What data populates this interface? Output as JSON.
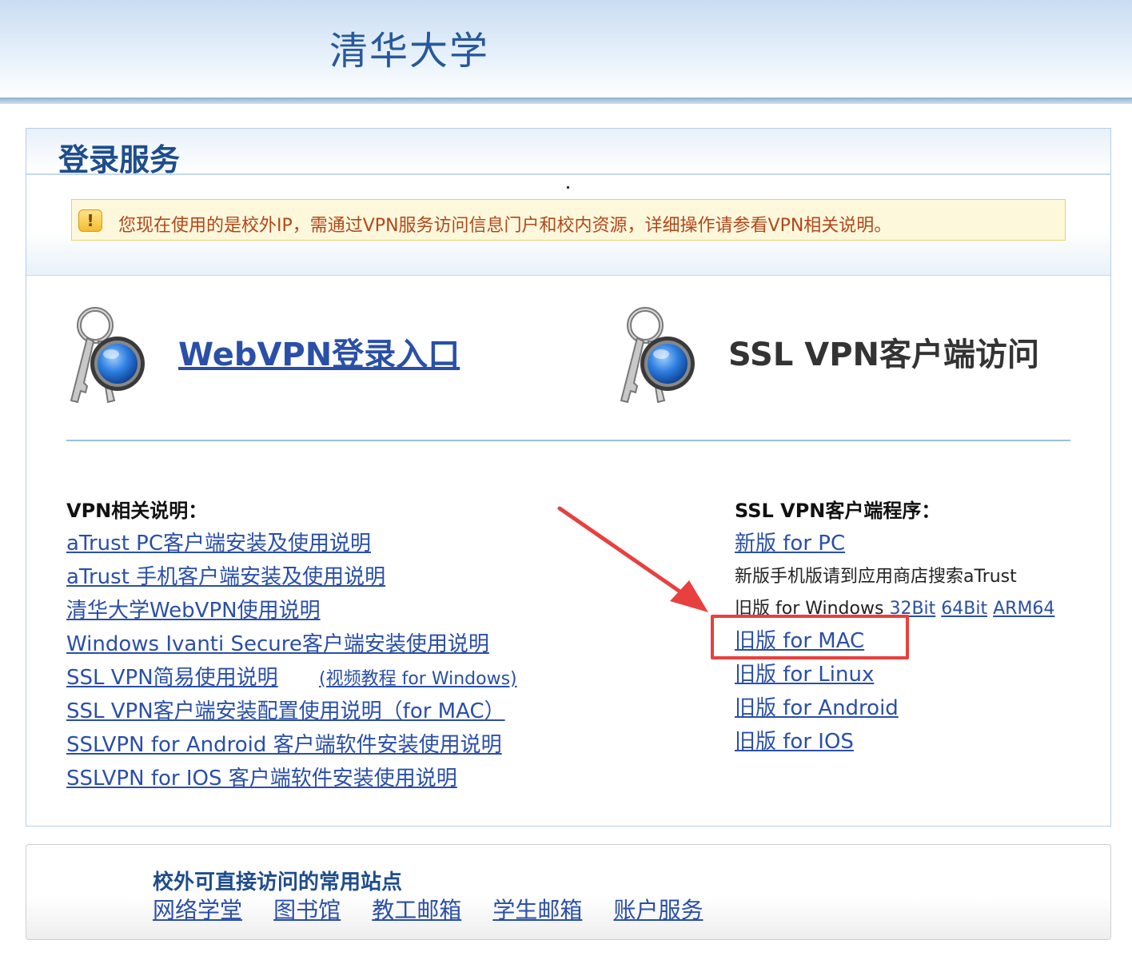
{
  "header": {
    "logo_text": "清华大学"
  },
  "login": {
    "title": "登录服务",
    "notice": "您现在使用的是校外IP，需通过VPN服务访问信息门户和校内资源，详细操作请参看VPN相关说明。",
    "webvpn_link": "WebVPN登录入口",
    "ssl_title": "SSL VPN客户端访问"
  },
  "docs": {
    "heading": "VPN相关说明：",
    "links": [
      "aTrust PC客户端安装及使用说明",
      "aTrust 手机客户端安装及使用说明",
      "清华大学WebVPN使用说明",
      "Windows Ivanti Secure客户端安装使用说明",
      "SSL VPN简易使用说明",
      "SSL VPN客户端安装配置使用说明（for MAC）",
      "SSLVPN for Android 客户端软件安装使用说明",
      "SSLVPN for IOS 客户端软件安装使用说明"
    ],
    "video_link": "(视频教程 for Windows)"
  },
  "clients": {
    "heading": "SSL VPN客户端程序：",
    "new_pc": "新版 for PC",
    "mobile_note": "新版手机版请到应用商店搜索aTrust",
    "old_windows_label": "旧版 for Windows",
    "win_32": "32Bit",
    "win_64": "64Bit",
    "win_arm": "ARM64",
    "old_mac": "旧版 for MAC",
    "old_linux": "旧版 for Linux",
    "old_android": "旧版 for Android",
    "old_ios": "旧版 for IOS"
  },
  "offcampus": {
    "title": "校外可直接访问的常用站点",
    "links": [
      "网络学堂",
      "图书馆",
      "教工邮箱",
      "学生邮箱",
      "账户服务"
    ]
  },
  "colors": {
    "link": "#2a4fa8",
    "brand": "#1e4d8c",
    "notice_text": "#b2471a",
    "annotation": "#e8403f"
  },
  "icons": {
    "notice": "warning-icon",
    "keys": "keys-icon"
  }
}
